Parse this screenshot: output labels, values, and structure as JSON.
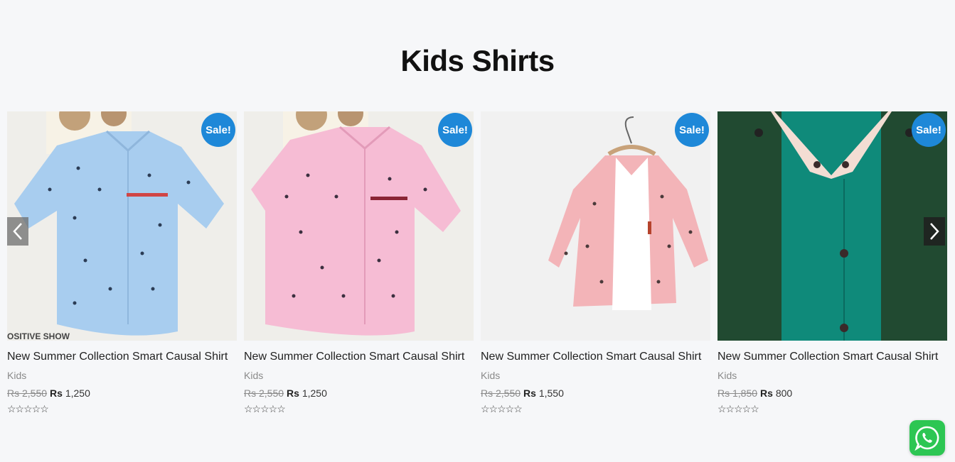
{
  "section": {
    "title": "Kids Shirts"
  },
  "products": [
    {
      "title": "New Summer Collection Smart Causal Shirt",
      "category": "Kids",
      "badge": "Sale!",
      "old_price": "Rs 2,550",
      "currency": "Rs",
      "new_price": "1,250",
      "rating": 0,
      "image_caption": "OSITIVE SHOW",
      "shirt_color": "#a8cdef"
    },
    {
      "title": "New Summer Collection Smart Causal Shirt",
      "category": "Kids",
      "badge": "Sale!",
      "old_price": "Rs 2,550",
      "currency": "Rs",
      "new_price": "1,250",
      "rating": 0,
      "shirt_color": "#f6bcd4"
    },
    {
      "title": "New Summer Collection Smart Causal Shirt",
      "category": "Kids",
      "badge": "Sale!",
      "old_price": "Rs 2,550",
      "currency": "Rs",
      "new_price": "1,550",
      "rating": 0,
      "shirt_color": "#f3b4b8"
    },
    {
      "title": "New Summer Collection Smart Causal Shirt",
      "category": "Kids",
      "badge": "Sale!",
      "old_price": "Rs 1,850",
      "currency": "Rs",
      "new_price": "800",
      "rating": 0,
      "shirt_color": "#0f8a7a"
    }
  ],
  "icons": {
    "prev": "chevron-left-icon",
    "next": "chevron-right-icon",
    "chat": "whatsapp-icon",
    "star": "star-outline-icon"
  },
  "colors": {
    "sale_badge": "#1e88d8",
    "whatsapp": "#2dc653",
    "background": "#f6f7f9"
  }
}
